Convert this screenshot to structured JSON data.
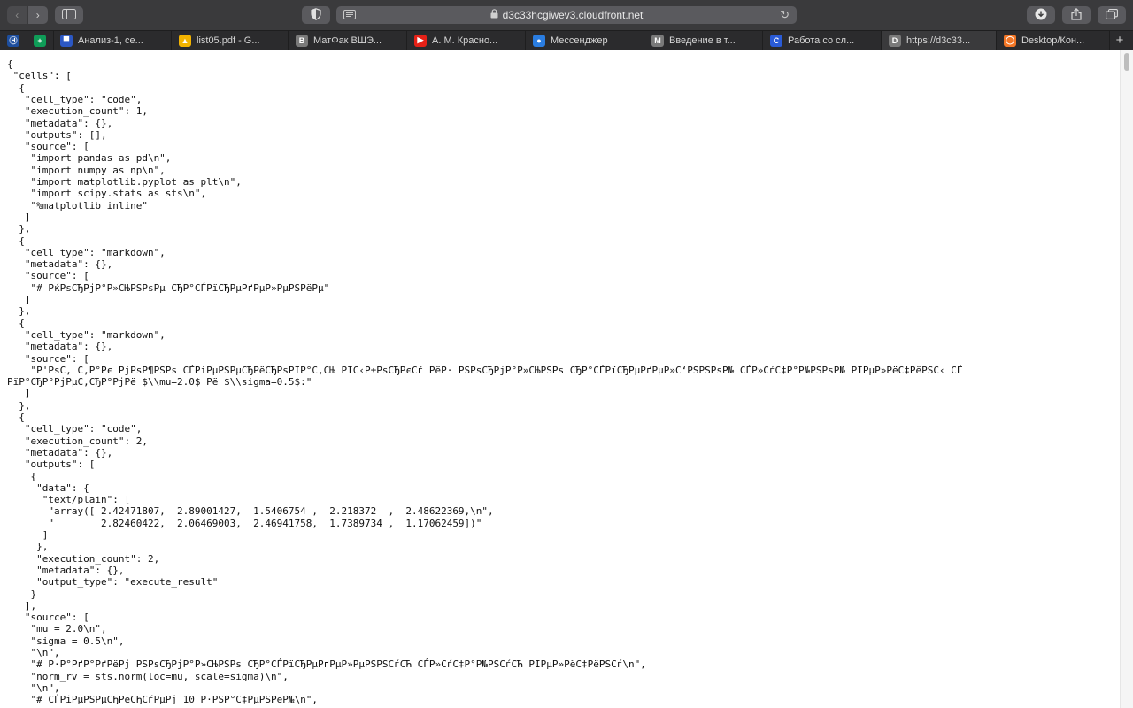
{
  "toolbar": {
    "back_icon": "‹",
    "forward_icon": "›",
    "sidebar_icon": "sidebar-icon",
    "shield_icon": "shield-icon",
    "url": "d3c33hcgiwev3.cloudfront.net",
    "download_icon": "download-icon",
    "share_icon": "share-icon",
    "tabs_icon": "tabs-overview-icon"
  },
  "tabs": [
    {
      "label": "",
      "color": "#1d4e9e",
      "glyph": "Ⓗ"
    },
    {
      "label": "",
      "color": "#0f9d58",
      "glyph": "+"
    },
    {
      "label": "Анализ-1, се...",
      "color": "#2b57c4",
      "glyph": "▀"
    },
    {
      "label": "list05.pdf - G...",
      "color": "#f4b400",
      "glyph": "▲"
    },
    {
      "label": "МатФак ВШЭ...",
      "color": "#7a7a7a",
      "glyph": "B"
    },
    {
      "label": "А. М. Красно...",
      "color": "#e62117",
      "glyph": "▶"
    },
    {
      "label": "Мессенджер",
      "color": "#2a7de1",
      "glyph": "●"
    },
    {
      "label": "Введение в т...",
      "color": "#7a7a7a",
      "glyph": "M"
    },
    {
      "label": "Работа со сл...",
      "color": "#2a5bd7",
      "glyph": "C"
    },
    {
      "label": "https://d3c33...",
      "color": "#7a7a7a",
      "glyph": "D",
      "active": true
    },
    {
      "label": "Desktop/Кон...",
      "color": "#f37626",
      "glyph": "◯"
    }
  ],
  "document_lines": [
    "{",
    " \"cells\": [",
    "  {",
    "   \"cell_type\": \"code\",",
    "   \"execution_count\": 1,",
    "   \"metadata\": {},",
    "   \"outputs\": [],",
    "   \"source\": [",
    "    \"import pandas as pd\\n\",",
    "    \"import numpy as np\\n\",",
    "    \"import matplotlib.pyplot as plt\\n\",",
    "    \"import scipy.stats as sts\\n\",",
    "    \"%matplotlib inline\"",
    "   ]",
    "  },",
    "  {",
    "   \"cell_type\": \"markdown\",",
    "   \"metadata\": {},",
    "   \"source\": [",
    "    \"# РќРѕСЂРјР°Р»СЊРЅРѕРµ СЂР°СЃРїСЂРµРґРµР»РµРЅРёРµ\"",
    "   ]",
    "  },",
    "  {",
    "   \"cell_type\": \"markdown\",",
    "   \"metadata\": {},",
    "   \"source\": [",
    "    \"Р'РѕС‚ С‚Р°Рє РјРѕР¶РЅРѕ СЃРіРµРЅРµСЂРёСЂРѕРІР°С‚СЊ РІС‹Р±РѕСЂРєСѓ РёР· РЅРѕСЂРјР°Р»СЊРЅРѕ СЂР°СЃРїСЂРµРґРµР»С‘РЅРЅРѕР№ СЃР»СѓС‡Р°Р№РЅРѕР№ РІРµР»РёС‡РёРЅС‹ СЃ",
    "РїР°СЂР°РјРµС‚СЂР°РјРё $\\\\mu=2.0$ Рё $\\\\sigma=0.5$:\"",
    "   ]",
    "  },",
    "  {",
    "   \"cell_type\": \"code\",",
    "   \"execution_count\": 2,",
    "   \"metadata\": {},",
    "   \"outputs\": [",
    "    {",
    "     \"data\": {",
    "      \"text/plain\": [",
    "       \"array([ 2.42471807,  2.89001427,  1.5406754 ,  2.218372  ,  2.48622369,\\n\",",
    "       \"        2.82460422,  2.06469003,  2.46941758,  1.7389734 ,  1.17062459])\"",
    "      ]",
    "     },",
    "     \"execution_count\": 2,",
    "     \"metadata\": {},",
    "     \"output_type\": \"execute_result\"",
    "    }",
    "   ],",
    "   \"source\": [",
    "    \"mu = 2.0\\n\",",
    "    \"sigma = 0.5\\n\",",
    "    \"\\n\",",
    "    \"# Р·Р°РґР°РґРёРј РЅРѕСЂРјР°Р»СЊРЅРѕ СЂР°СЃРїСЂРµРґРµР»РµРЅРЅСѓСЋ СЃР»СѓС‡Р°Р№РЅСѓСЋ РІРµР»РёС‡РёРЅСѓ\\n\",",
    "    \"norm_rv = sts.norm(loc=mu, scale=sigma)\\n\",",
    "    \"\\n\",",
    "    \"# СЃРіРµРЅРµСЂРёСЂСѓРµРј 10 Р·РЅР°С‡РµРЅРёР№\\n\","
  ]
}
